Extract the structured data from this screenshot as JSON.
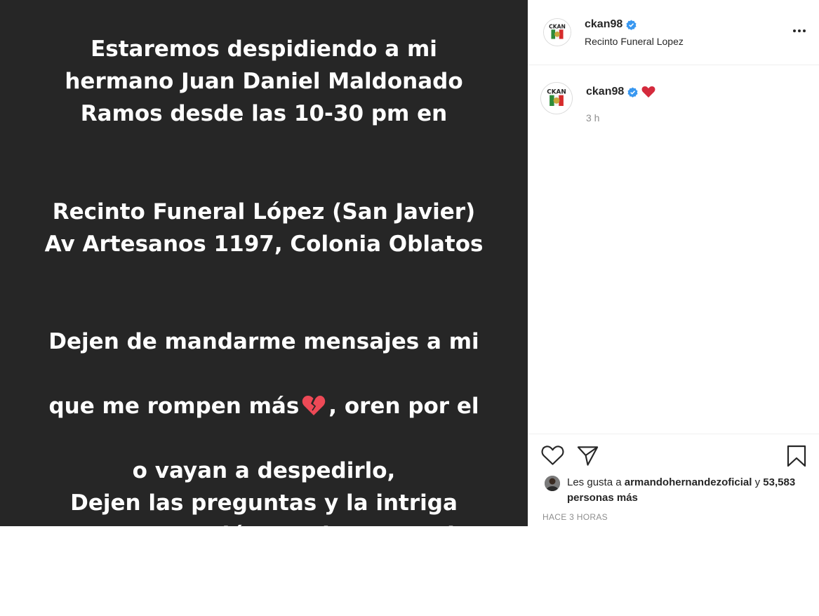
{
  "post": {
    "paragraph1": "Estaremos despidiendo a mi\nhermano Juan Daniel Maldonado\nRamos desde las 10-30 pm  en",
    "paragraph2": "Recinto Funeral López (San Javier)\nAv Artesanos 1197, Colonia Oblatos",
    "paragraph3_line1": "Dejen de mandarme mensajes a mi",
    "paragraph3_line2_before": "que me rompen más",
    "paragraph3_line2_after": ", oren por el",
    "paragraph3_rest": "o vayan a despedirlo,\nDejen las preguntas y la intriga\npara otra ocasión.gracias por todos\nlos mensajes de amor hacia el",
    "emoji": "broken-heart-icon"
  },
  "header": {
    "username": "ckan98",
    "location": "Recinto Funeral Lopez",
    "avatar_text": "CKAN"
  },
  "caption": {
    "username": "ckan98",
    "emoji": "red-heart-icon",
    "time": "3 h"
  },
  "engagement": {
    "likes_prefix": "Les gusta a",
    "liker": "armandohernandezoficial",
    "likes_joiner": "y",
    "others_count": "53,583",
    "others_suffix": "personas más",
    "timestamp": "HACE 3 HORAS"
  },
  "colors": {
    "image_bg": "#262626",
    "verified_blue": "#3897f0",
    "heart_red": "#ed4956",
    "muted": "#8e8e8e"
  }
}
